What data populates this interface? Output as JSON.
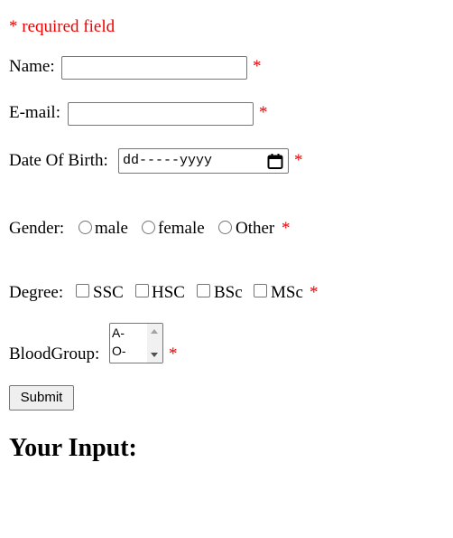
{
  "required_note": "* required field",
  "asterisk": "*",
  "name": {
    "label": "Name:",
    "value": ""
  },
  "email": {
    "label": "E-mail:",
    "value": ""
  },
  "dob": {
    "label": "Date Of Birth:",
    "placeholder": "dd-----yyyy",
    "icon": "calendar-icon"
  },
  "gender": {
    "label": "Gender:",
    "options": [
      "male",
      "female",
      "Other"
    ]
  },
  "degree": {
    "label": "Degree:",
    "options": [
      "SSC",
      "HSC",
      "BSc",
      "MSc"
    ]
  },
  "blood_group": {
    "label": "BloodGroup:",
    "visible_options": [
      "A-",
      "O-"
    ]
  },
  "submit_label": "Submit",
  "output_heading": "Your Input:",
  "colors": {
    "required": "#ee0000",
    "border": "#767676",
    "button_bg": "#efefef"
  }
}
